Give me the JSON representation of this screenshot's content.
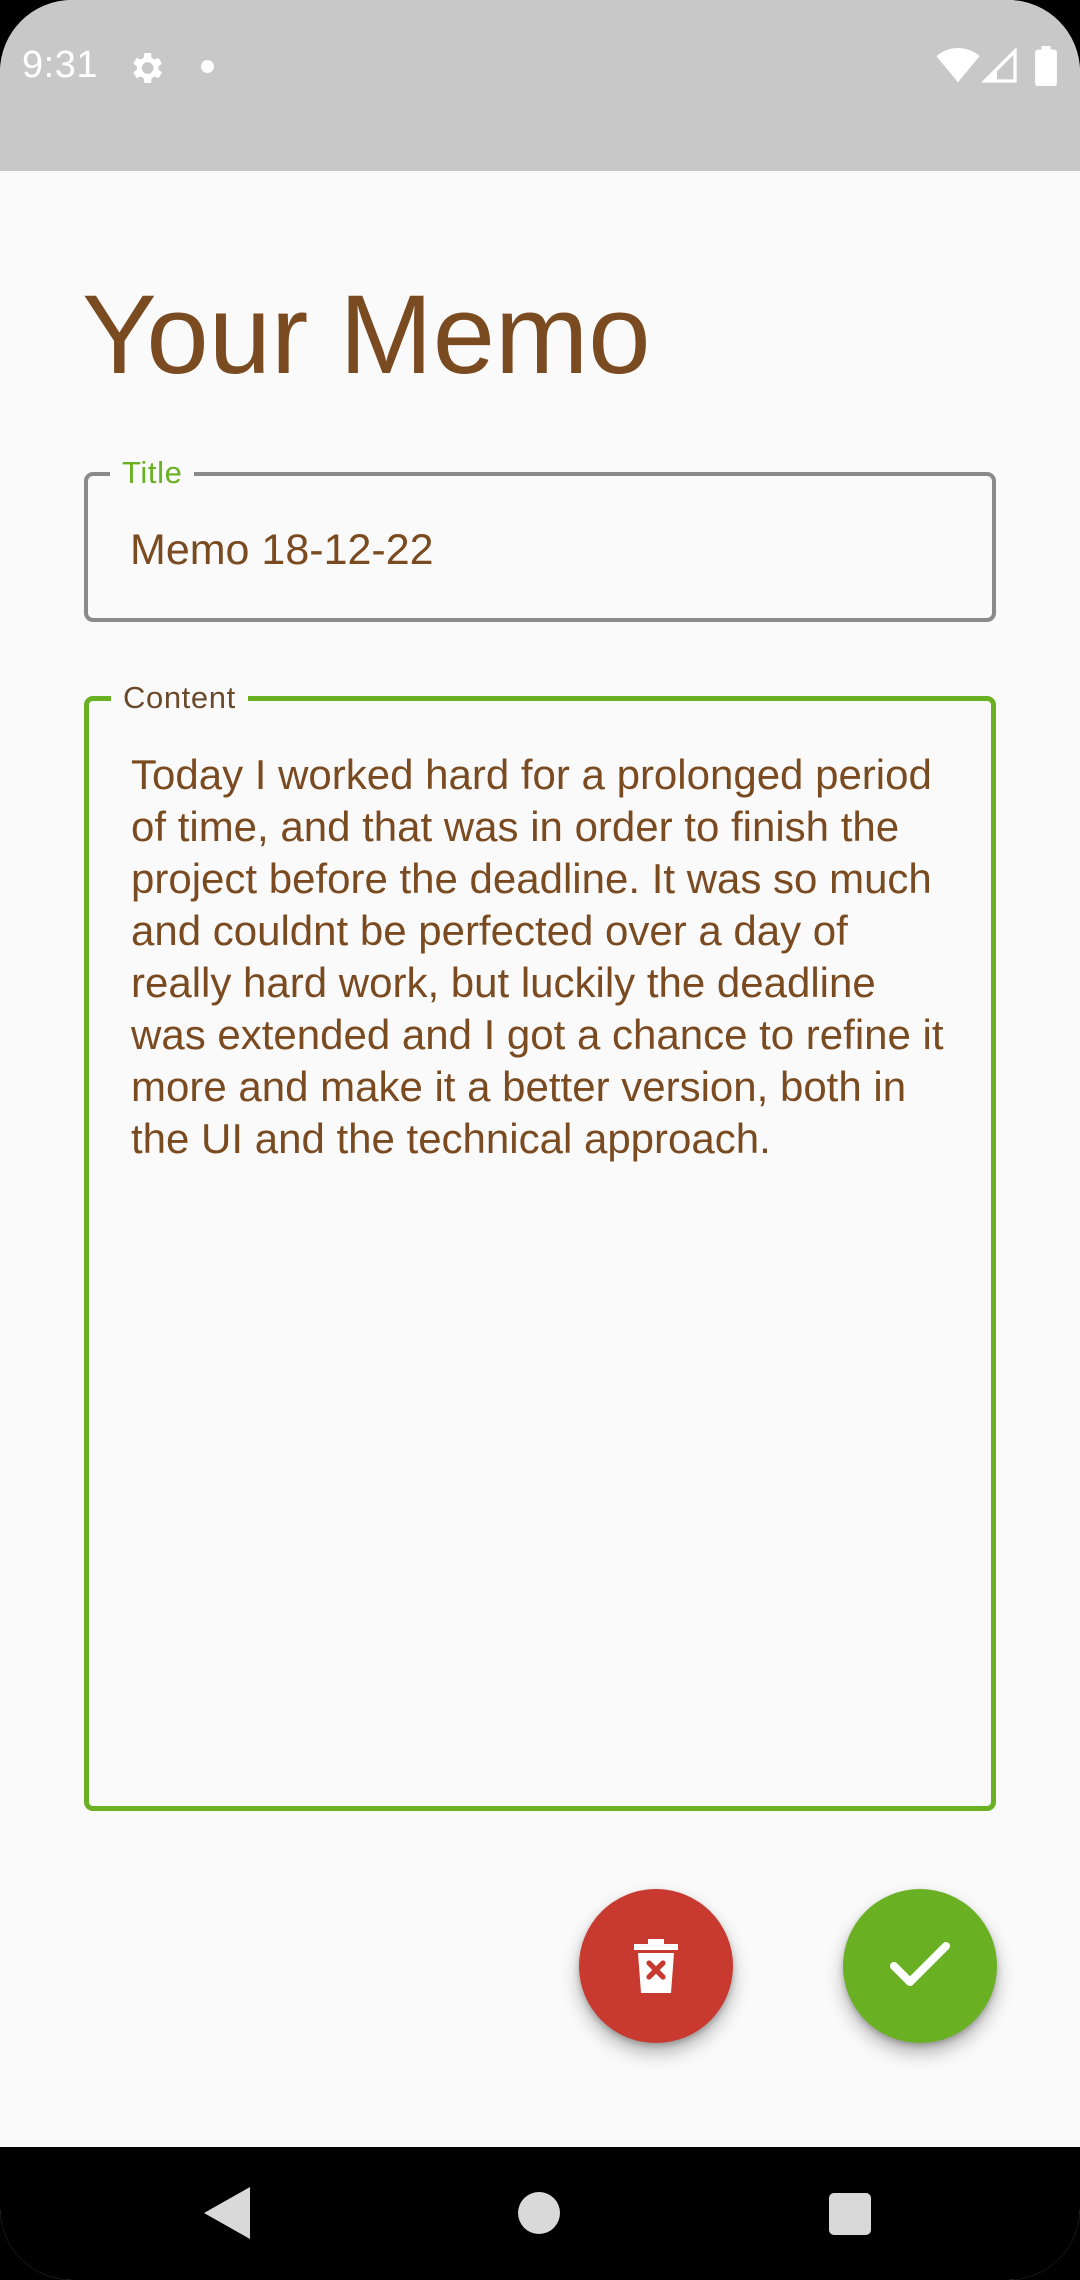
{
  "status_bar": {
    "time": "9:31",
    "icons": [
      "gear-icon",
      "notification-dot-icon",
      "wifi-icon",
      "signal-icon",
      "battery-icon"
    ]
  },
  "page": {
    "title": "Your Memo"
  },
  "form": {
    "title_label": "Title",
    "title_value": "Memo 18-12-22",
    "content_label": "Content",
    "content_value": "Today I worked hard for a prolonged period of time, and that was in order to finish the project before the deadline. It was so much and couldnt be perfected over a day of really hard work, but luckily the deadline was extended and I got a chance to refine it more and make it a better version, both in the UI and the technical approach."
  },
  "actions": {
    "delete_icon": "trash-icon",
    "confirm_icon": "check-icon"
  },
  "colors": {
    "title_text": "#7a4a20",
    "accent_green": "#6ab023",
    "delete_red": "#c8392f",
    "status_bar_bg": "#c8c8c8"
  },
  "nav_bar": {
    "icons": [
      "back-icon",
      "home-icon",
      "recents-icon"
    ]
  }
}
